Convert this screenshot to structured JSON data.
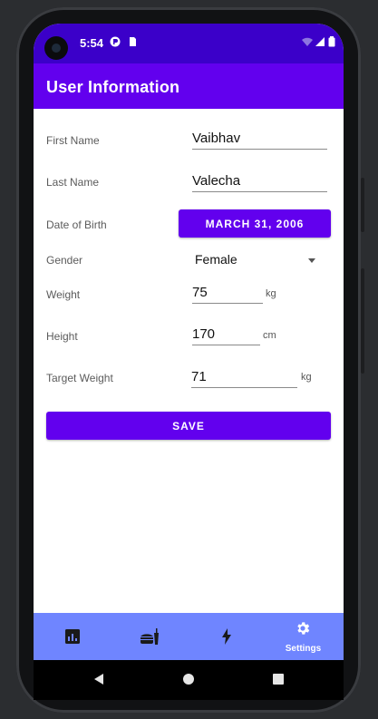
{
  "status": {
    "time": "5:54"
  },
  "appbar": {
    "title": "User Information"
  },
  "form": {
    "first_name_label": "First Name",
    "first_name_value": "Vaibhav",
    "last_name_label": "Last Name",
    "last_name_value": "Valecha",
    "dob_label": "Date of Birth",
    "dob_button": "MARCH 31, 2006",
    "gender_label": "Gender",
    "gender_value": "Female",
    "weight_label": "Weight",
    "weight_value": "75",
    "weight_unit": "kg",
    "height_label": "Height",
    "height_value": "170",
    "height_unit": "cm",
    "target_weight_label": "Target Weight",
    "target_weight_value": "71",
    "target_weight_unit": "kg",
    "save_label": "SAVE"
  },
  "bottom_nav": {
    "items": [
      {
        "icon": "chart-icon",
        "label": ""
      },
      {
        "icon": "food-icon",
        "label": ""
      },
      {
        "icon": "bolt-icon",
        "label": ""
      },
      {
        "icon": "gear-icon",
        "label": "Settings"
      }
    ]
  },
  "colors": {
    "statusbar": "#3b00c9",
    "primary": "#6200ee",
    "bottom_nav": "#6f85ff"
  }
}
